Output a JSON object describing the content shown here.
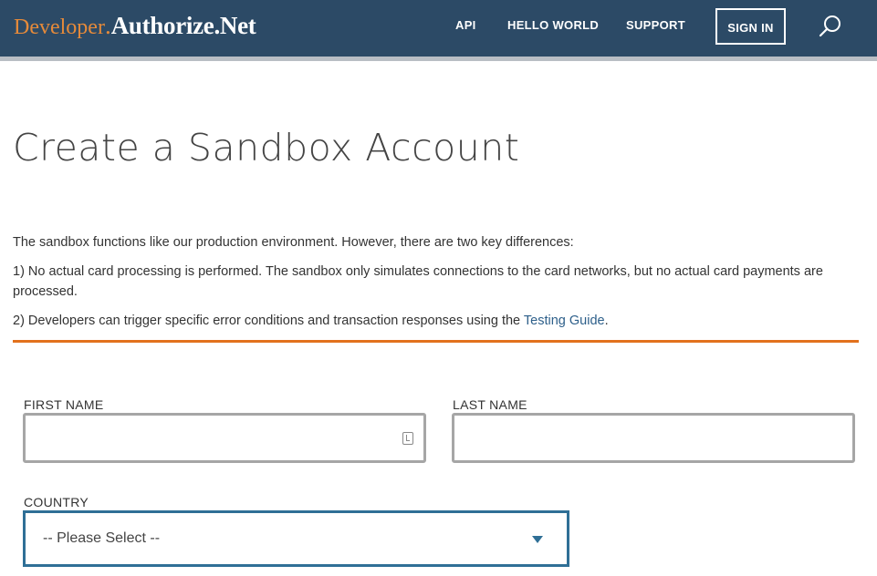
{
  "header": {
    "logo": {
      "developer": "Developer",
      "dot": ".",
      "brand": "Authorize.Net"
    },
    "nav": [
      {
        "label": "API"
      },
      {
        "label": "HELLO WORLD"
      },
      {
        "label": "SUPPORT"
      }
    ],
    "sign_in_label": "SIGN IN",
    "search_icon": "search-icon"
  },
  "main": {
    "title": "Create a Sandbox Account",
    "intro": "The sandbox functions like our production environment. However, there are two key differences:",
    "point1": "1) No actual card processing is performed. The sandbox only simulates connections to the card networks, but no actual card payments are processed.",
    "point2_prefix": "2) Developers can trigger specific error conditions and transaction responses using the ",
    "point2_link": "Testing Guide",
    "point2_suffix": "."
  },
  "form": {
    "first_name": {
      "label": "FIRST NAME",
      "value": "",
      "placeholder": ""
    },
    "last_name": {
      "label": "LAST NAME",
      "value": "",
      "placeholder": ""
    },
    "country": {
      "label": "COUNTRY",
      "selected": "-- Please Select --"
    }
  },
  "colors": {
    "header_bg": "#2c4a66",
    "accent_orange": "#e2711d",
    "link_blue": "#2d5f8a",
    "focus_blue": "#2f6f96"
  }
}
